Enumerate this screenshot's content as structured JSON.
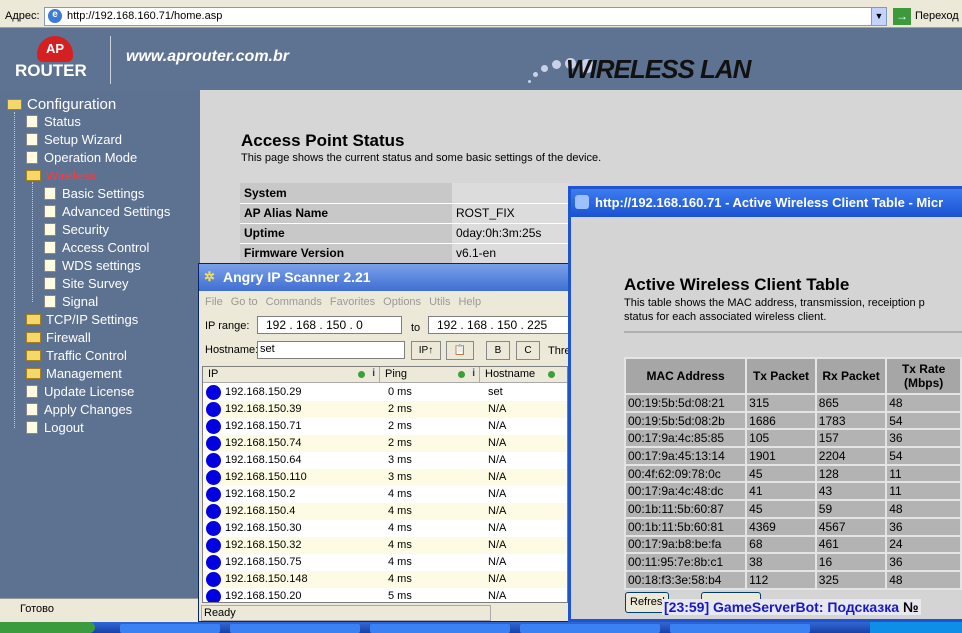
{
  "browser": {
    "address_label": "Адрес:",
    "url": "http://192.168.160.71/home.asp",
    "go_label": "Переход",
    "status": "Готово"
  },
  "banner": {
    "logo_top": "AP",
    "logo_bottom": "ROUTER",
    "site": "www.aprouter.com.br",
    "product": "WIRELESS LAN"
  },
  "sidebar": {
    "root": "Configuration",
    "items": [
      {
        "label": "Status",
        "level": 1
      },
      {
        "label": "Setup Wizard",
        "level": 1
      },
      {
        "label": "Operation Mode",
        "level": 1
      },
      {
        "label": "Wireless",
        "level": 1,
        "folder": true,
        "selected": true
      },
      {
        "label": "Basic Settings",
        "level": 2
      },
      {
        "label": "Advanced Settings",
        "level": 2
      },
      {
        "label": "Security",
        "level": 2
      },
      {
        "label": "Access Control",
        "level": 2
      },
      {
        "label": "WDS settings",
        "level": 2
      },
      {
        "label": "Site Survey",
        "level": 2
      },
      {
        "label": "Signal",
        "level": 2
      },
      {
        "label": "TCP/IP Settings",
        "level": 1,
        "folder": true
      },
      {
        "label": "Firewall",
        "level": 1,
        "folder": true
      },
      {
        "label": "Traffic Control",
        "level": 1,
        "folder": true
      },
      {
        "label": "Management",
        "level": 1,
        "folder": true
      },
      {
        "label": "Update License",
        "level": 1
      },
      {
        "label": "Apply Changes",
        "level": 1
      },
      {
        "label": "Logout",
        "level": 1
      }
    ]
  },
  "ap_status": {
    "title": "Access Point Status",
    "desc": "This page shows the current status and some basic settings of the device.",
    "section": "System",
    "rows": [
      {
        "k": "AP Alias Name",
        "v": "ROST_FIX"
      },
      {
        "k": "Uptime",
        "v": "0day:0h:3m:25s"
      },
      {
        "k": "Firmware Version",
        "v": "v6.1-en"
      }
    ]
  },
  "scanner": {
    "title": "Angry IP Scanner 2.21",
    "menu": [
      "File",
      "Go to",
      "Commands",
      "Favorites",
      "Options",
      "Utils",
      "Help"
    ],
    "ip_range_label": "IP range:",
    "from": [
      "192",
      "168",
      "150",
      "0"
    ],
    "to_label": "to",
    "to": [
      "192",
      "168",
      "150",
      "225"
    ],
    "hostname_label": "Hostname:",
    "hostname": "set",
    "ip_btn": "IP↑",
    "class_b": "B",
    "class_c": "C",
    "threads": "Thre",
    "columns": [
      "IP",
      "Ping",
      "Hostname"
    ],
    "rows": [
      [
        "192.168.150.29",
        "0 ms",
        "set"
      ],
      [
        "192.168.150.39",
        "2 ms",
        "N/A"
      ],
      [
        "192.168.150.71",
        "2 ms",
        "N/A"
      ],
      [
        "192.168.150.74",
        "2 ms",
        "N/A"
      ],
      [
        "192.168.150.64",
        "3 ms",
        "N/A"
      ],
      [
        "192.168.150.110",
        "3 ms",
        "N/A"
      ],
      [
        "192.168.150.2",
        "4 ms",
        "N/A"
      ],
      [
        "192.168.150.4",
        "4 ms",
        "N/A"
      ],
      [
        "192.168.150.30",
        "4 ms",
        "N/A"
      ],
      [
        "192.168.150.32",
        "4 ms",
        "N/A"
      ],
      [
        "192.168.150.75",
        "4 ms",
        "N/A"
      ],
      [
        "192.168.150.148",
        "4 ms",
        "N/A"
      ],
      [
        "192.168.150.20",
        "5 ms",
        "N/A"
      ]
    ],
    "status": "Ready"
  },
  "clients": {
    "window_title": "http://192.168.160.71 - Active Wireless Client Table - Micr",
    "title": "Active Wireless Client Table",
    "desc1": "This table shows the MAC address, transmission, receiption p",
    "desc2": "status for each associated wireless client.",
    "columns": [
      "MAC Address",
      "Tx Packet",
      "Rx Packet",
      "Tx Rate (Mbps)"
    ],
    "rows": [
      [
        "00:19:5b:5d:08:21",
        "315",
        "865",
        "48"
      ],
      [
        "00:19:5b:5d:08:2b",
        "1686",
        "1783",
        "54"
      ],
      [
        "00:17:9a:4c:85:85",
        "105",
        "157",
        "36"
      ],
      [
        "00:17:9a:45:13:14",
        "1901",
        "2204",
        "54"
      ],
      [
        "00:4f:62:09:78:0c",
        "45",
        "128",
        "11"
      ],
      [
        "00:17:9a:4c:48:dc",
        "41",
        "43",
        "11"
      ],
      [
        "00:1b:11:5b:60:87",
        "45",
        "59",
        "48"
      ],
      [
        "00:1b:11:5b:60:81",
        "4369",
        "4567",
        "36"
      ],
      [
        "00:17:9a:b8:be:fa",
        "68",
        "461",
        "24"
      ],
      [
        "00:11:95:7e:8b:c1",
        "38",
        "16",
        "36"
      ],
      [
        "00:18:f3:3e:58:b4",
        "112",
        "325",
        "48"
      ]
    ],
    "refresh": "Refresh"
  },
  "chat_overlay": {
    "text": "[23:59] GameServerBot:  Подсказка",
    "suffix": "№"
  }
}
